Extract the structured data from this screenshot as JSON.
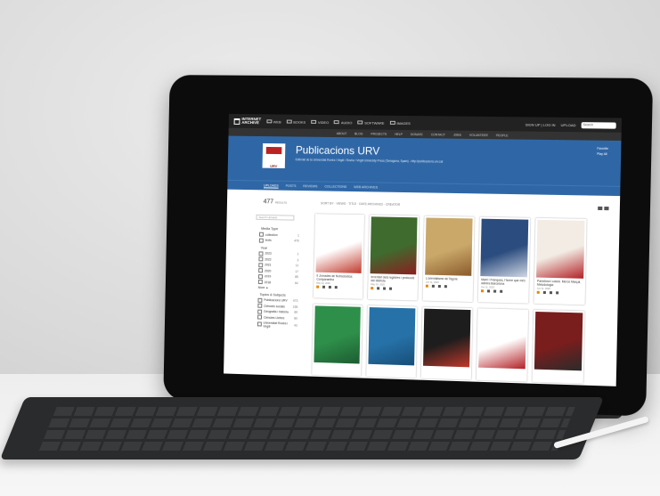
{
  "colors": {
    "banner": "#2f67a6",
    "topbar": "#222222",
    "accent": "#e58a00"
  },
  "topbar": {
    "logo_line1": "INTERNET",
    "logo_line2": "ARCHIVE",
    "items": [
      "WEB",
      "BOOKS",
      "VIDEO",
      "AUDIO",
      "SOFTWARE",
      "IMAGES"
    ],
    "signin": "SIGN UP | LOG IN",
    "upload": "UPLOAD",
    "search_placeholder": "Search"
  },
  "subnav": [
    "ABOUT",
    "BLOG",
    "PROJECTS",
    "HELP",
    "DONATE",
    "CONTACT",
    "JOBS",
    "VOLUNTEER",
    "PEOPLE"
  ],
  "banner": {
    "title": "Publicacions URV",
    "description": "Editorial de la Universitat Rovira i Virgili / Rovira i Virgili University Press (Tarragona, Spain) - http://publicacions.urv.cat",
    "logo_text": "URV",
    "links": [
      "Favorite",
      "Play All"
    ]
  },
  "tabs": [
    "UPLOADS",
    "POSTS",
    "REVIEWS",
    "COLLECTIONS",
    "WEB ARCHIVES"
  ],
  "main": {
    "count": "477",
    "count_label": "RESULTS",
    "sort": "SORT BY · VIEWS · TITLE · DATE ARCHIVED · CREATOR"
  },
  "sidebar": {
    "search_placeholder": "Search Uploads",
    "media_heading": "Media Type",
    "media": [
      {
        "label": "collection",
        "n": "1"
      },
      {
        "label": "texts",
        "n": "476"
      }
    ],
    "year_heading": "Year",
    "years": [
      {
        "label": "2023",
        "n": "1"
      },
      {
        "label": "2022",
        "n": "3"
      },
      {
        "label": "2021",
        "n": "11"
      },
      {
        "label": "2020",
        "n": "17"
      },
      {
        "label": "2019",
        "n": "85"
      },
      {
        "label": "2018",
        "n": "64"
      }
    ],
    "more": "More",
    "topics_heading": "Topics & Subjects",
    "topics": [
      {
        "label": "Publicacions URV",
        "n": "473"
      },
      {
        "label": "Ciències socials",
        "n": "158"
      },
      {
        "label": "Geografia i història",
        "n": "89"
      },
      {
        "label": "Ciències Lletres",
        "n": "80"
      },
      {
        "label": "Universitat Rovira i Virgili",
        "n": "43"
      }
    ]
  },
  "cards": [
    {
      "title": "II Jornades de Nutracèutica: Comparantha",
      "date": "May 10, 2020",
      "cover": "#ffffff",
      "accent": "#c0392b"
    },
    {
      "title": "Inventari dels registres i protocols del districte",
      "date": "May 10, 2020",
      "cover": "#3f6b2e",
      "accent": "#8a1f1f"
    },
    {
      "title": "L'orientalisme de Tagore",
      "date": "Jun 11, 2020",
      "cover": "#c9a86a",
      "accent": "#8a5a2b"
    },
    {
      "title": "Martí i Franquès, l'home que més admira Barcelona",
      "date": "Jun 11, 2020",
      "cover": "#2b4c7e",
      "accent": "#d0d7e4"
    },
    {
      "title": "Paradoxa i colors. Mercè Marçal, Metodologia",
      "date": "Jun 11, 2020",
      "cover": "#f2ece4",
      "accent": "#b21f24"
    },
    {
      "title": "",
      "date": "",
      "cover": "#2e8f4a",
      "accent": "#1d5c31"
    },
    {
      "title": "",
      "date": "",
      "cover": "#2672a8",
      "accent": "#174e78"
    },
    {
      "title": "",
      "date": "",
      "cover": "#1d1d1d",
      "accent": "#c0392b"
    },
    {
      "title": "",
      "date": "",
      "cover": "#ffffff",
      "accent": "#b21f24"
    },
    {
      "title": "",
      "date": "",
      "cover": "#7a1d1d",
      "accent": "#2b2b2b"
    }
  ]
}
